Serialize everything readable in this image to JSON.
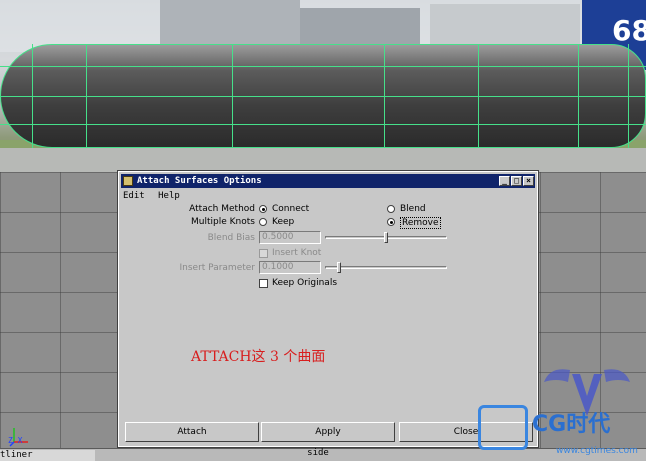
{
  "background": {
    "tail_text": "68",
    "axis_label": "Z X",
    "outliner_tab": "tliner",
    "side_tab": "side"
  },
  "dialog": {
    "title": "Attach Surfaces Options",
    "menus": [
      "Edit",
      "Help"
    ],
    "attach_method": {
      "label": "Attach Method",
      "options": [
        {
          "label": "Connect",
          "selected": true
        },
        {
          "label": "Blend",
          "selected": false
        }
      ]
    },
    "multiple_knots": {
      "label": "Multiple Knots",
      "options": [
        {
          "label": "Keep",
          "selected": false
        },
        {
          "label": "Remove",
          "selected": true
        }
      ]
    },
    "blend_bias": {
      "label": "Blend Bias",
      "value": "0.5000",
      "fraction": 0.5
    },
    "insert_knot": {
      "label": "Insert Knot",
      "checked": false,
      "enabled": false
    },
    "insert_parameter": {
      "label": "Insert Parameter",
      "value": "0.1000",
      "fraction": 0.1
    },
    "keep_originals": {
      "label": "Keep Originals",
      "checked": false
    },
    "annotation": "ATTACH这 3 个曲面",
    "buttons": {
      "attach": "Attach",
      "apply": "Apply",
      "close": "Close"
    }
  },
  "watermark": {
    "brand": "CG时代",
    "site": "www.cgtimes.com"
  },
  "colors": {
    "title_bar": "#10246a",
    "isoparm": "#46e08a",
    "annotation": "#d81e1e"
  }
}
